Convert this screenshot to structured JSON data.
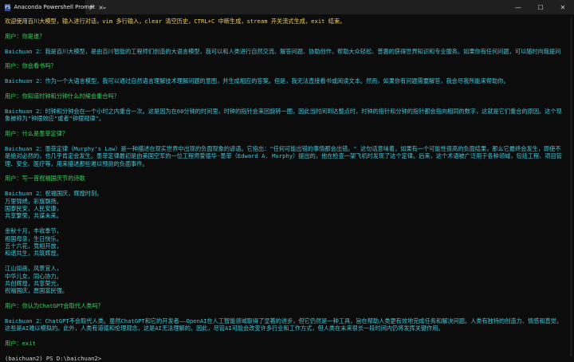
{
  "window": {
    "tab_title": "Anaconda Powershell Prompt",
    "tab_icon": "PS",
    "close_tab_glyph": "×",
    "new_tab_glyph": "+",
    "dropdown_glyph": "⌄",
    "minimize_glyph": "—",
    "maximize_glyph": "☐",
    "close_glyph": "✕"
  },
  "colors": {
    "system": "#f2d05a",
    "user": "#3bd15f",
    "assistant": "#45c6d9",
    "prompt": "#d6d6d6"
  },
  "terminal": {
    "lines": [
      {
        "c": "yellow",
        "t": "欢迎使用百川大模型，输入进行对话，vim 多行输入，clear 清空历史，CTRL+C 中断生成，stream 开关流式生成，exit 结束。"
      },
      {
        "c": "",
        "t": ""
      },
      {
        "c": "green",
        "t": "用户：你是谁？"
      },
      {
        "c": "",
        "t": ""
      },
      {
        "c": "cyan",
        "t": "Baichuan 2：我是百川大模型，是由百川智能的工程师们创造的大语言模型，我可以和人类进行自然交流、解答问题、协助创作，帮助大众轻松、普惠的获得世界知识和专业服务。如果你有任何问题，可以随时向我提问"
      },
      {
        "c": "",
        "t": ""
      },
      {
        "c": "green",
        "t": "用户：你会看书吗？"
      },
      {
        "c": "",
        "t": ""
      },
      {
        "c": "cyan",
        "t": "Baichuan 2：作为一个大语言模型，我可以通过自然语言理解技术理解问题的意图，并生成相应的答案。但是，我无法直接看书或阅读文本。然而，如果你有问题需要解答，我会尽我所能来帮助你。"
      },
      {
        "c": "",
        "t": ""
      },
      {
        "c": "green",
        "t": "用户：你知道时钟和分钟什么时候会重合吗？"
      },
      {
        "c": "",
        "t": ""
      },
      {
        "c": "cyan",
        "t": "Baichuan 2：时钟和分钟会在一个小时之内重合一次。这是因为在60分钟的时间里，时钟的指针会来回旋转一圈，因此当时间到达整点时，时钟的指针和分钟的指针都会指向相同的数字，这就是它们重合的原因。这个现象被称为\"钟摆效应\"或者\"钟摆规律\"。"
      },
      {
        "c": "",
        "t": ""
      },
      {
        "c": "green",
        "t": "用户：什么是墨菲定律？"
      },
      {
        "c": "",
        "t": ""
      },
      {
        "c": "cyan",
        "t": "Baichuan 2：墨菲定律（Murphy's Law）是一种描述在现实世界中出现的负面现象的谚语。它指出：\"任何可能出错的事情都会出错。\" 这句话意味着，如果有一个可能性很高的负面结果，那么它最终会发生，即使不是绝对必然的，也几乎肯定会发生。墨菲定律最初是由美国空军的一位工程师爱德华·墨菲（Edward A. Murphy）提出的，他在检查一架飞机时发现了这个定律。后来，这个术语被广泛用于各种领域，包括工程、项目管理、安全、医疗等，用来描述那些难以预测的负面事件。"
      },
      {
        "c": "",
        "t": ""
      },
      {
        "c": "green",
        "t": "用户：写一首祝福国庆节的诗歌"
      },
      {
        "c": "",
        "t": ""
      },
      {
        "c": "cyan",
        "t": "Baichuan 2：祝福国庆，辉煌时刻，"
      },
      {
        "c": "cyan",
        "t": "万里锦绣，彩旗飘扬。"
      },
      {
        "c": "cyan",
        "t": "国泰民安，人民安康，"
      },
      {
        "c": "cyan",
        "t": "共享繁荣，共谋未来。"
      },
      {
        "c": "",
        "t": ""
      },
      {
        "c": "cyan",
        "t": "金秋十月，丰收季节，"
      },
      {
        "c": "cyan",
        "t": "祖国母亲，生日快乐。"
      },
      {
        "c": "cyan",
        "t": "五十六花，竞相开放，"
      },
      {
        "c": "cyan",
        "t": "和谐共生，共筑辉煌。"
      },
      {
        "c": "",
        "t": ""
      },
      {
        "c": "cyan",
        "t": "江山如画，风景宜人，"
      },
      {
        "c": "cyan",
        "t": "中华儿女，同心协力。"
      },
      {
        "c": "cyan",
        "t": "共创辉煌，共享荣光，"
      },
      {
        "c": "cyan",
        "t": "祝福国庆，愿国富民强。"
      },
      {
        "c": "",
        "t": ""
      },
      {
        "c": "green",
        "t": "用户：你认为ChatGPT会取代人类吗？"
      },
      {
        "c": "",
        "t": ""
      },
      {
        "c": "cyan",
        "t": "Baichuan 2：ChatGPT不会取代人类。虽然ChatGPT和它的开发者——OpenAI在人工智能领域取得了显著的进步，但它仍然是一种工具，旨在帮助人类更有效地完成任务和解决问题。人类有独特的创造力、情感和直觉，这些是AI难以模拟的。此外，人类有道德和伦理观念，这是AI无法理解的。因此，尽管AI可能会改变许多行业和工作方式，但人类在未来很长一段时间内仍将发挥关键作用。"
      },
      {
        "c": "",
        "t": ""
      },
      {
        "c": "green",
        "t": "用户：exit"
      },
      {
        "c": "",
        "t": ""
      },
      {
        "c": "white",
        "t": "(baichuan2) PS D:\\baichuan2>"
      }
    ]
  }
}
